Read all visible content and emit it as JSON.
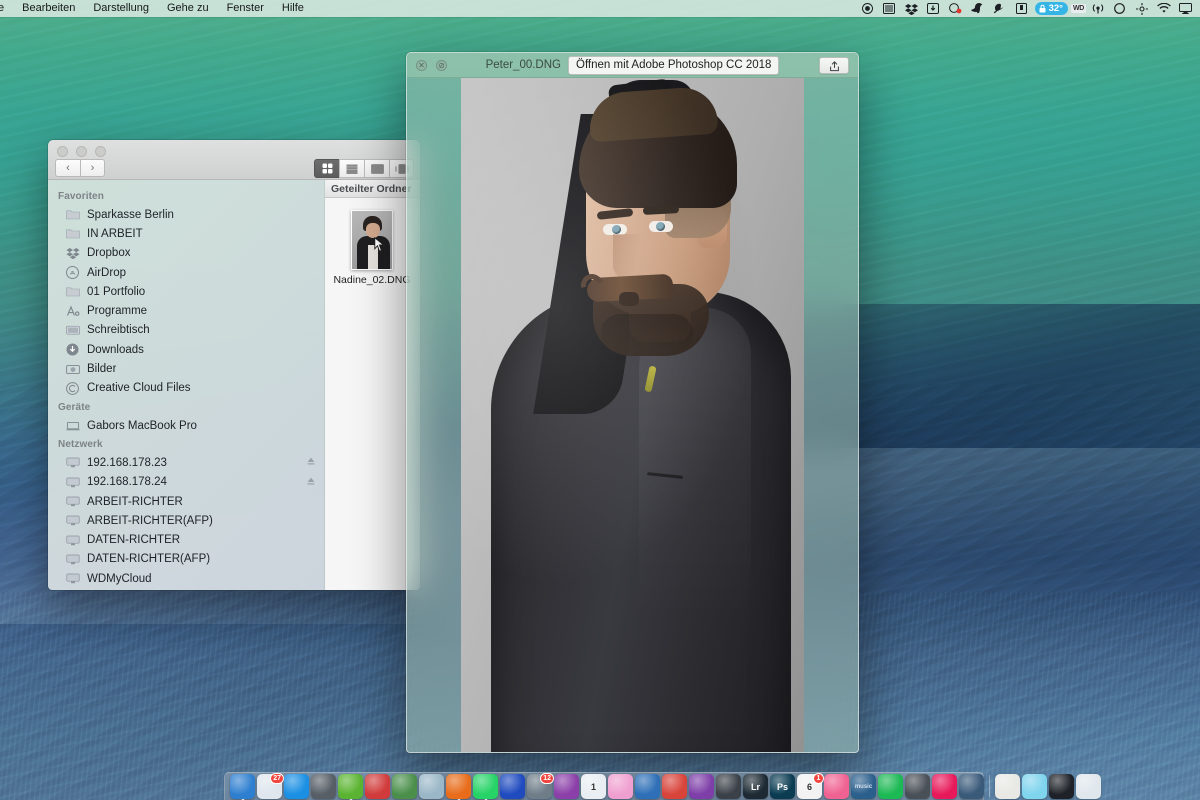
{
  "menubar": {
    "items": [
      {
        "label": "e",
        "bold": false,
        "name": "menu-ablage-truncated"
      },
      {
        "label": "Bearbeiten",
        "bold": false,
        "name": "menu-bearbeiten"
      },
      {
        "label": "Darstellung",
        "bold": false,
        "name": "menu-darstellung"
      },
      {
        "label": "Gehe zu",
        "bold": false,
        "name": "menu-gehe-zu"
      },
      {
        "label": "Fenster",
        "bold": false,
        "name": "menu-fenster"
      },
      {
        "label": "Hilfe",
        "bold": false,
        "name": "menu-hilfe"
      }
    ],
    "status_icons": [
      "record-icon",
      "screen-icon",
      "dropbox-icon",
      "download-arrow-icon",
      "dot-green-icon",
      "parrot-icon",
      "acrobat-icon",
      "book-icon"
    ],
    "weather": {
      "temperature": "32°"
    },
    "wd_label": "WD",
    "trailing_icons": [
      "antenna-icon",
      "circle-icon",
      "crosshair-icon",
      "wifi-icon",
      "airplay-icon"
    ]
  },
  "finder": {
    "nav": {
      "back": "‹",
      "forward": "›"
    },
    "views": [
      {
        "name": "view-icons",
        "active": true
      },
      {
        "name": "view-list",
        "active": false
      },
      {
        "name": "view-columns",
        "active": false
      },
      {
        "name": "view-gallery",
        "active": false
      }
    ],
    "sidebar": {
      "sections": [
        {
          "header": "Favoriten",
          "items": [
            {
              "label": "Sparkasse Berlin",
              "icon": "folder-icon",
              "eject": false
            },
            {
              "label": "IN ARBEIT",
              "icon": "folder-icon",
              "eject": false
            },
            {
              "label": "Dropbox",
              "icon": "dropbox-icon",
              "eject": false
            },
            {
              "label": "AirDrop",
              "icon": "airdrop-icon",
              "eject": false
            },
            {
              "label": "01 Portfolio",
              "icon": "folder-icon",
              "eject": false
            },
            {
              "label": "Programme",
              "icon": "applications-icon",
              "eject": false
            },
            {
              "label": "Schreibtisch",
              "icon": "desktop-icon",
              "eject": false
            },
            {
              "label": "Downloads",
              "icon": "downloads-icon",
              "eject": false
            },
            {
              "label": "Bilder",
              "icon": "pictures-icon",
              "eject": false
            },
            {
              "label": "Creative Cloud Files",
              "icon": "creative-cloud-icon",
              "eject": false
            }
          ]
        },
        {
          "header": "Geräte",
          "items": [
            {
              "label": "Gabors MacBook Pro",
              "icon": "laptop-icon",
              "eject": false
            }
          ]
        },
        {
          "header": "Netzwerk",
          "items": [
            {
              "label": "192.168.178.23",
              "icon": "server-icon",
              "eject": true
            },
            {
              "label": "192.168.178.24",
              "icon": "server-icon",
              "eject": true
            },
            {
              "label": "ARBEIT-RICHTER",
              "icon": "server-icon",
              "eject": false
            },
            {
              "label": "ARBEIT-RICHTER(AFP)",
              "icon": "server-icon",
              "eject": false
            },
            {
              "label": "DATEN-RICHTER",
              "icon": "server-icon",
              "eject": false
            },
            {
              "label": "DATEN-RICHTER(AFP)",
              "icon": "server-icon",
              "eject": false
            },
            {
              "label": "WDMyCloud",
              "icon": "server-icon",
              "eject": false
            }
          ]
        }
      ]
    },
    "content": {
      "column_header": "Geteilter Ordner",
      "files": [
        {
          "name": "Nadine_02.DNG",
          "kind": "image-thumbnail"
        }
      ]
    }
  },
  "preview": {
    "filename": "Peter_00.DNG",
    "open_with_label": "Öffnen mit Adobe Photoshop CC 2018",
    "share_icon": "share-icon",
    "close_glyph": "✕",
    "minimize_glyph": "⊘",
    "photo_description": "Portrait of a man with styled hair, mustache and beard wearing a dark jacket on a gray backdrop"
  },
  "dock": {
    "items": [
      {
        "name": "finder",
        "color": "#2f7fd0",
        "glyph": "",
        "badge": "",
        "running": true
      },
      {
        "name": "mail",
        "color": "#dfe6ee",
        "glyph": "",
        "badge": "27",
        "running": false
      },
      {
        "name": "safari",
        "color": "#1a8fe3",
        "glyph": "",
        "badge": "",
        "running": false
      },
      {
        "name": "launchpad",
        "color": "#575e66",
        "glyph": "",
        "badge": "",
        "running": false
      },
      {
        "name": "evernote",
        "color": "#5bb431",
        "glyph": "",
        "badge": "",
        "running": true
      },
      {
        "name": "kindle",
        "color": "#d13b3b",
        "glyph": "",
        "badge": "",
        "running": false
      },
      {
        "name": "arrow-app",
        "color": "#4b8f4b",
        "glyph": "",
        "badge": "",
        "running": false
      },
      {
        "name": "skype",
        "color": "#9ab7c7",
        "glyph": "",
        "badge": "",
        "running": false
      },
      {
        "name": "firefox",
        "color": "#e86c1a",
        "glyph": "",
        "badge": "",
        "running": true
      },
      {
        "name": "whatsapp",
        "color": "#25d366",
        "glyph": "",
        "badge": "",
        "running": true
      },
      {
        "name": "opera-neon",
        "color": "#1f4bbf",
        "glyph": "",
        "badge": "",
        "running": false
      },
      {
        "name": "transmit",
        "color": "#6f7d89",
        "glyph": "",
        "badge": "12",
        "running": false
      },
      {
        "name": "browser-app",
        "color": "#8b3fa8",
        "glyph": "",
        "badge": "",
        "running": false
      },
      {
        "name": "1password",
        "color": "#e9eef3",
        "glyph": "1",
        "badge": "",
        "running": false
      },
      {
        "name": "photos",
        "color": "#f0a0d0",
        "glyph": "",
        "badge": "",
        "running": false
      },
      {
        "name": "affinity-designer",
        "color": "#2e6fb7",
        "glyph": "",
        "badge": "",
        "running": false
      },
      {
        "name": "ibooks",
        "color": "#d8433a",
        "glyph": "",
        "badge": "",
        "running": false
      },
      {
        "name": "affinity-photo",
        "color": "#7e3fa8",
        "glyph": "",
        "badge": "",
        "running": false
      },
      {
        "name": "camera-app",
        "color": "#3b4148",
        "glyph": "",
        "badge": "",
        "running": false
      },
      {
        "name": "lightroom",
        "color": "#1d2a33",
        "glyph": "Lr",
        "badge": "",
        "running": false
      },
      {
        "name": "photoshop",
        "color": "#0b3c52",
        "glyph": "Ps",
        "badge": "",
        "running": false
      },
      {
        "name": "calendar",
        "color": "#f2f2f2",
        "glyph": "6",
        "badge": "1",
        "running": false
      },
      {
        "name": "itunes",
        "color": "#f06292",
        "glyph": "",
        "badge": "",
        "running": false
      },
      {
        "name": "amazon-music",
        "color": "#2b5f8c",
        "glyph": "music",
        "badge": "",
        "running": false
      },
      {
        "name": "spotify",
        "color": "#1db954",
        "glyph": "",
        "badge": "",
        "running": false
      },
      {
        "name": "app-store",
        "color": "#4a5057",
        "glyph": "",
        "badge": "",
        "running": false
      },
      {
        "name": "red-app",
        "color": "#e8195a",
        "glyph": "",
        "badge": "",
        "running": false
      },
      {
        "name": "quicktime",
        "color": "#3a5a7a",
        "glyph": "",
        "badge": "",
        "running": false
      },
      {
        "name": "documents-stack",
        "color": "#e8e8e4",
        "glyph": "",
        "badge": "",
        "running": false
      },
      {
        "name": "downloads-folder",
        "color": "#7fd4ee",
        "glyph": "",
        "badge": "",
        "running": false
      },
      {
        "name": "screenshot-folder",
        "color": "#1e2228",
        "glyph": "",
        "badge": "",
        "running": false
      },
      {
        "name": "trash",
        "color": "#dfe6ec",
        "glyph": "",
        "badge": "",
        "running": false
      }
    ]
  }
}
